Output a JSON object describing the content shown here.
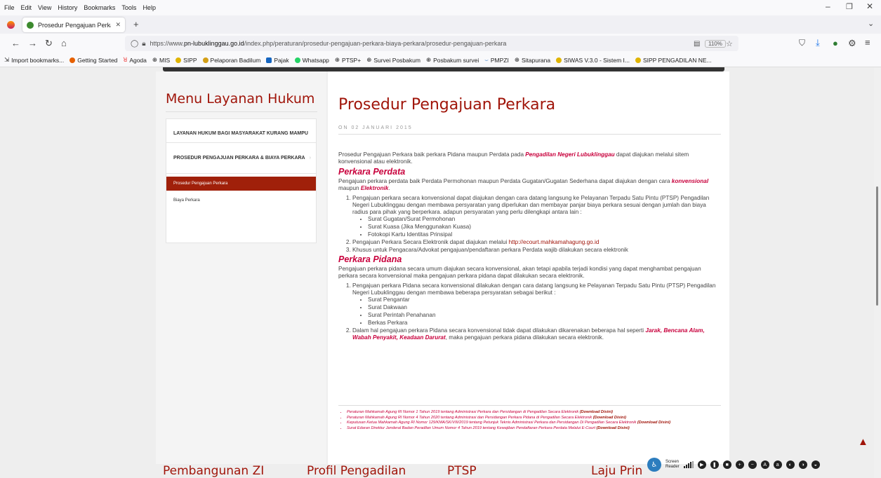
{
  "menu": [
    "File",
    "Edit",
    "View",
    "History",
    "Bookmarks",
    "Tools",
    "Help"
  ],
  "tab": {
    "title": "Prosedur Pengajuan Perkara"
  },
  "url": {
    "prefix": "https://www.",
    "domain": "pn-lubuklinggau.go.id",
    "path": "/index.php/peraturan/prosedur-pengajuan-perkara-biaya-perkara/prosedur-pengajuan-perkara",
    "zoom": "110%"
  },
  "bookmarks": [
    "Import bookmarks...",
    "Getting Started",
    "Agoda",
    "MIS",
    "SIPP",
    "Pelaporan Badilum",
    "Pajak",
    "Whatsapp",
    "PTSP+",
    "Survei Posbakum",
    "Posbakum survei",
    "PMPZI",
    "Sitapurana",
    "SIWAS V.3.0 - Sistem I...",
    "SIPP PENGADILAN NE..."
  ],
  "sidebar": {
    "heading": "Menu Layanan Hukum",
    "items": [
      "LAYANAN HUKUM BAGI MASYARAKAT KURANG MAMPU",
      "PROSEDUR PENGAJUAN PERKARA & BIAYA PERKARA",
      "Prosedur Pengajuan Perkara",
      "Biaya Perkara"
    ]
  },
  "article": {
    "title": "Prosedur Pengajuan Perkara",
    "date": "ON 02 JANUARI 2015",
    "intro_a": "Prosedur Pengajuan Perkara baik perkara Pidana maupun Perdata pada ",
    "intro_hl": "Pengadilan Negeri Lubuklinggau",
    "intro_b": " dapat diajukan melalui sitem konvensional atau elektronik.",
    "perdata_heading": "Perkara Perdata",
    "perdata_a": "Pengajuan perkara perdata baik Perdata Permohonan maupun Perdata Gugatan/Gugatan Sederhana dapat diajukan dengan cara ",
    "perdata_hl1": "konvensional",
    "perdata_mid": " maupun ",
    "perdata_hl2": "Elektronik",
    "perdata_end": ".",
    "perdata_li1": "Pengajuan perkara secara konvensional dapat diajukan dengan cara datang langsung ke Pelayanan Terpadu Satu Pintu (PTSP) Pengadilan Negeri Lubuklinggau dengan membawa persyaratan yang diperlukan dan membayar panjar biaya perkara sesuai dengan jumlah dan biaya radius para pihak yang berperkara. adapun persyaratan yang perlu dilengkapi antara lain :",
    "perdata_req": [
      "Surat Gugatan/Surat Permohonan",
      "Surat Kuasa (Jika Menggunakan Kuasa)",
      "Fotokopi Kartu Identitas Prinsipal"
    ],
    "perdata_li2_a": "Pengajuan Perkara Secara Elektronik dapat diajukan melalui ",
    "perdata_li2_link": "http://ecourt.mahkamahagung.go.id",
    "perdata_li3": "Khusus untuk Pengacara/Advokat pengajuan/pendaftaran perkara Perdata wajib dilakukan secara elektronik",
    "pidana_heading": "Perkara Pidana",
    "pidana_p": "Pengajuan perkara pidana secara umum diajukan secara konvensional, akan tetapi apabila terjadi kondisi yang dapat menghambat pengajuan perkara secara konvensional maka pengajuan perkara pidana dapat dilakukan secara elektronik.",
    "pidana_li1": "Pengajuan perkara Pidana secara konvensional dilakukan dengan cara datang langsung ke Pelayanan Terpadu Satu Pintu (PTSP) Pengadilan Negeri Lubuklinggau dengan membawa beberapa persyaratan sebagai berikut :",
    "pidana_req": [
      "Surat Pengantar",
      "Surat Dakwaan",
      "Surat Perintah Penahanan",
      "Berkas Perkara"
    ],
    "pidana_li2_a": "Dalam hal pengajuan perkara Pidana secara konvensional tidak dapat dilakukan dikarenakan beberapa hal seperti ",
    "pidana_li2_hl": "Jarak, Bencana Alam, Wabah Penyakit, Keadaan Darurat",
    "pidana_li2_b": ", maka pengajuan perkara pidana dilakukan secara elektronik.",
    "refs": [
      {
        "text": "Peraturan Mahkamah Agung RI Nomor 1 Tahun 2019 tentang Administrasi Perkara dan Persidangan di Pengadilan Secara Elektronik ",
        "dl": "(Download Disini)"
      },
      {
        "text": "Peraturan Mahkamah Agung RI Nomor 4 Tahun 2020 tentang Administrasi dan Persidangan Perkara Pidana di Pengadilan Secara Elektronik ",
        "dl": "(Download Disini)"
      },
      {
        "text": "Keputusan Ketua Mahkamah Agung RI Nomor 129/KMA/SK/VIII/2019 tentang Petunjuk Teknis Administrasi Perkara dan Persidangan Di Pengadilan Secara Elektronik ",
        "dl": "(Download Disini)"
      },
      {
        "text": "Surat Edaran Direktur Jenderal Badan Peradilan Umum Nomor 4 Tahun 2019 tentang Kewajiban Pendaftaran Perkara Perdata Melalui E-Court ",
        "dl": "(Download Disini)"
      }
    ]
  },
  "footer": [
    "Pembangunan ZI",
    "Profil Pengadilan",
    "PTSP",
    "Laju Prin"
  ],
  "access": {
    "label1": "Screen",
    "label2": "Reader"
  }
}
